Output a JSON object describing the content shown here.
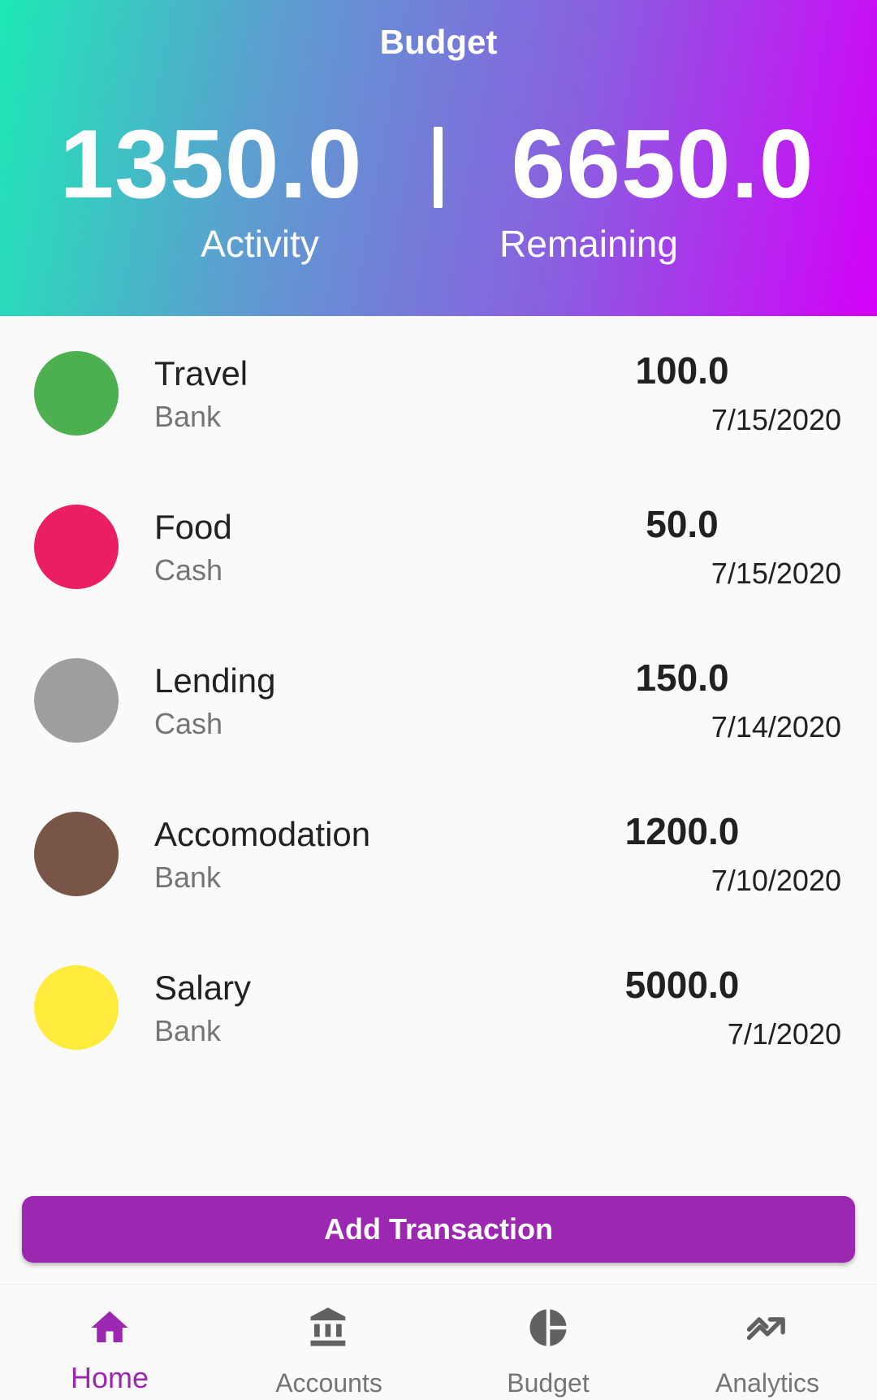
{
  "header": {
    "title": "Budget",
    "activity": {
      "value": "1350.0",
      "label": "Activity"
    },
    "separator": "|",
    "remaining": {
      "value": "6650.0",
      "label": "Remaining"
    }
  },
  "transactions": [
    {
      "category": "Travel",
      "account": "Bank",
      "amount": "100.0",
      "date": "7/15/2020",
      "color": "#4caf50"
    },
    {
      "category": "Food",
      "account": "Cash",
      "amount": "50.0",
      "date": "7/15/2020",
      "color": "#e91e63"
    },
    {
      "category": "Lending",
      "account": "Cash",
      "amount": "150.0",
      "date": "7/14/2020",
      "color": "#9e9e9e"
    },
    {
      "category": "Accomodation",
      "account": "Bank",
      "amount": "1200.0",
      "date": "7/10/2020",
      "color": "#795548"
    },
    {
      "category": "Salary",
      "account": "Bank",
      "amount": "5000.0",
      "date": "7/1/2020",
      "color": "#ffeb3b"
    }
  ],
  "actions": {
    "add_transaction_label": "Add Transaction"
  },
  "bottom_nav": {
    "items": [
      {
        "label": "Home",
        "icon": "home-icon",
        "active": true
      },
      {
        "label": "Accounts",
        "icon": "bank-icon",
        "active": false
      },
      {
        "label": "Budget",
        "icon": "pie-chart-icon",
        "active": false
      },
      {
        "label": "Analytics",
        "icon": "trending-up-icon",
        "active": false
      }
    ]
  },
  "colors": {
    "accent": "#9c27b0",
    "header_gradient_start": "#1de9b6",
    "header_gradient_end": "#d500f9",
    "inactive_icon": "#616161"
  }
}
